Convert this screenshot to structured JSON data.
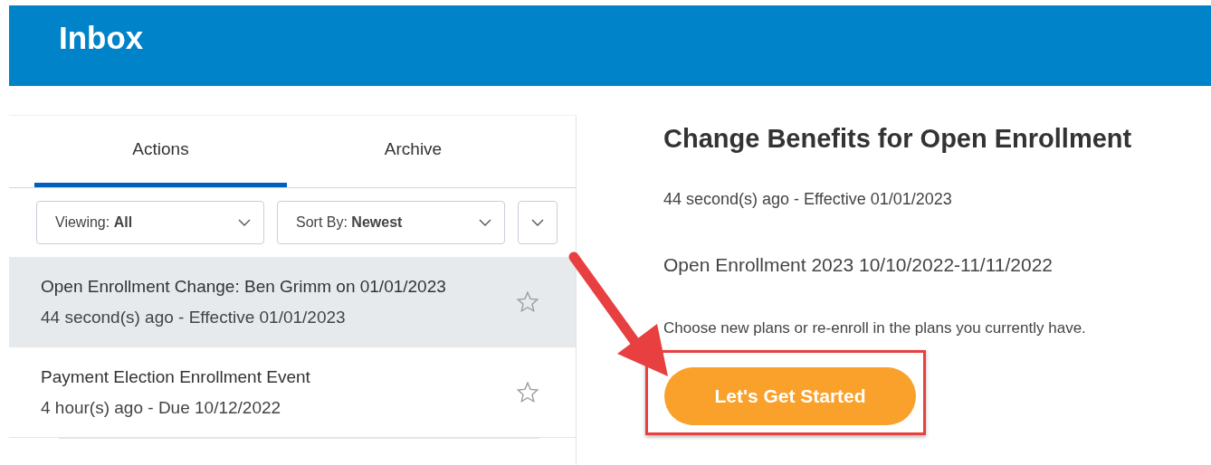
{
  "header": {
    "title": "Inbox"
  },
  "tabs": [
    {
      "label": "Actions",
      "selected": true
    },
    {
      "label": "Archive",
      "selected": false
    }
  ],
  "filters": [
    {
      "label": "Viewing: **All**"
    },
    {
      "label": "Sort By: **Newest**"
    }
  ],
  "items": [
    {
      "title": "Open Enrollment Change: Ben Grimm on 01/01/2023",
      "subtitle": "44 second(s) ago - Effective 01/01/2023",
      "selected": true,
      "starred": false
    },
    {
      "title": "Payment Election Enrollment Event",
      "subtitle": "4 hour(s) ago - Due 10/12/2022",
      "selected": false,
      "starred": false
    }
  ],
  "detail": {
    "title": "Change Benefits for Open Enrollment",
    "meta": "44 second(s) ago -  Effective 01/01/2023",
    "event": "Open Enrollment 2023 10/10/2022-11/11/2022",
    "description": "Choose new plans or re-enroll in the plans you currently have.",
    "button": "Let's Get Started"
  }
}
